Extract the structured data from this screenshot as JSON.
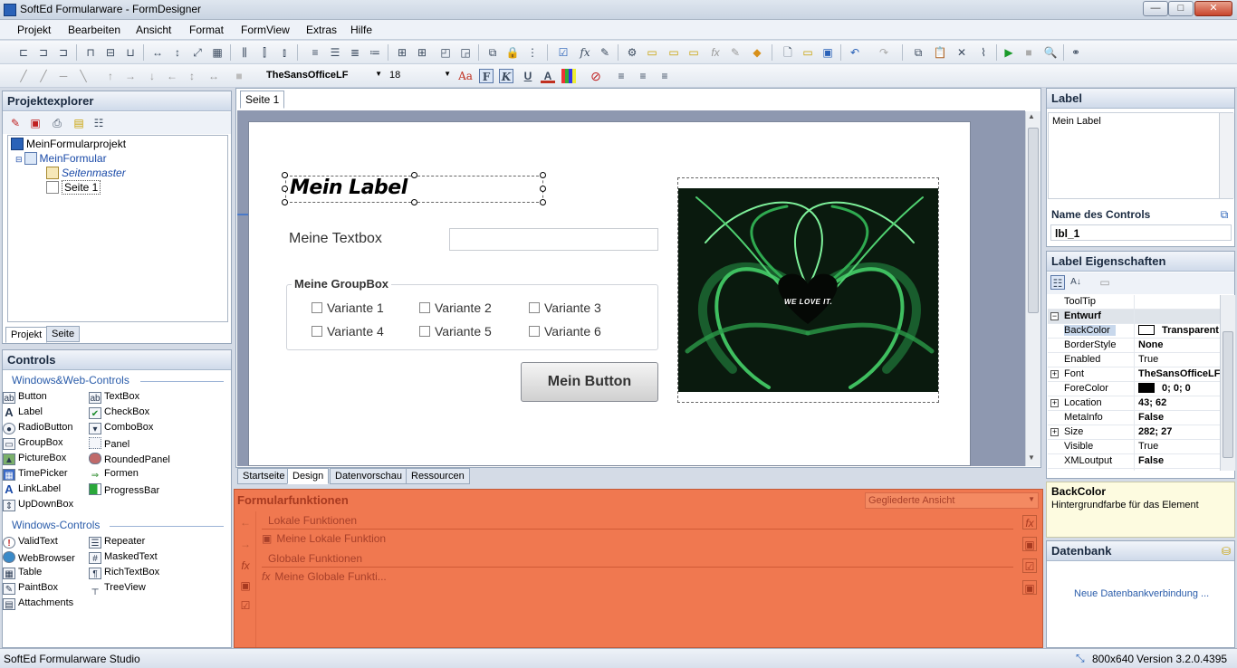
{
  "window": {
    "title": "SoftEd Formularware - FormDesigner"
  },
  "menu": [
    "Projekt",
    "Bearbeiten",
    "Ansicht",
    "Format",
    "FormView",
    "Extras",
    "Hilfe"
  ],
  "format_toolbar": {
    "font": "TheSansOfficeLF",
    "size": "18",
    "bold": "F",
    "italic": "K",
    "underline": "U",
    "color": "A"
  },
  "project_explorer": {
    "title": "Projektexplorer",
    "tree": [
      "MeinFormularprojekt",
      "MeinFormular",
      "Seitenmaster",
      "Seite 1"
    ],
    "tabs": [
      "Projekt",
      "Seite"
    ]
  },
  "controls": {
    "title": "Controls",
    "section1": "Windows&Web-Controls",
    "left1": [
      "Button",
      "Label",
      "RadioButton",
      "GroupBox",
      "PictureBox",
      "TimePicker",
      "LinkLabel",
      "UpDownBox"
    ],
    "right1": [
      "TextBox",
      "CheckBox",
      "ComboBox",
      "Panel",
      "RoundedPanel",
      "Formen",
      "ProgressBar"
    ],
    "section2": "Windows-Controls",
    "left2": [
      "ValidText",
      "WebBrowser",
      "Table",
      "PaintBox",
      "Attachments"
    ],
    "right2": [
      "Repeater",
      "MaskedText",
      "RichTextBox",
      "TreeView"
    ]
  },
  "page_tab": "Seite 1",
  "form": {
    "label": "Mein Label",
    "textbox_label": "Meine Textbox",
    "groupbox_title": "Meine GroupBox",
    "variants": [
      "Variante 1",
      "Variante 2",
      "Variante 3",
      "Variante 4",
      "Variante 5",
      "Variante 6"
    ],
    "button": "Mein Button",
    "image_text": "WE LOVE IT."
  },
  "bottom_tabs": [
    "Startseite",
    "Design",
    "Datenvorschau",
    "Ressourcen"
  ],
  "functions": {
    "title": "Formularfunktionen",
    "view": "Gegliederte Ansicht",
    "local_header": "Lokale Funktionen",
    "local_item": "Meine Lokale Funktion",
    "global_header": "Globale Funktionen",
    "global_item": "Meine Globale Funkti..."
  },
  "label_panel": {
    "title": "Label",
    "text": "Mein Label",
    "name_caption": "Name des Controls",
    "name_value": "lbl_1"
  },
  "properties": {
    "title": "Label Eigenschaften",
    "rows": [
      {
        "name": "ToolTip",
        "value": ""
      },
      {
        "name": "Entwurf",
        "value": ""
      },
      {
        "name": "BackColor",
        "value": "Transparent"
      },
      {
        "name": "BorderStyle",
        "value": "None"
      },
      {
        "name": "Enabled",
        "value": "True"
      },
      {
        "name": "Font",
        "value": "TheSansOfficeLF"
      },
      {
        "name": "ForeColor",
        "value": "0; 0; 0"
      },
      {
        "name": "Location",
        "value": "43; 62"
      },
      {
        "name": "MetaInfo",
        "value": "False"
      },
      {
        "name": "Size",
        "value": "282; 27"
      },
      {
        "name": "Visible",
        "value": "True"
      },
      {
        "name": "XMLoutput",
        "value": "False"
      }
    ],
    "desc_title": "BackColor",
    "desc_text": "Hintergrundfarbe für das Element"
  },
  "database": {
    "title": "Datenbank",
    "link": "Neue Datenbankverbindung ..."
  },
  "status": {
    "left": "SoftEd Formularware Studio",
    "size": "800x640",
    "version": "Version 3.2.0.4395"
  },
  "colors": {
    "accent": "#2a62b8",
    "functions_bg": "#f07850",
    "panel_head": "#cfdaea"
  },
  "winbtns": {
    "min": "—",
    "max": "□",
    "close": "✕"
  }
}
